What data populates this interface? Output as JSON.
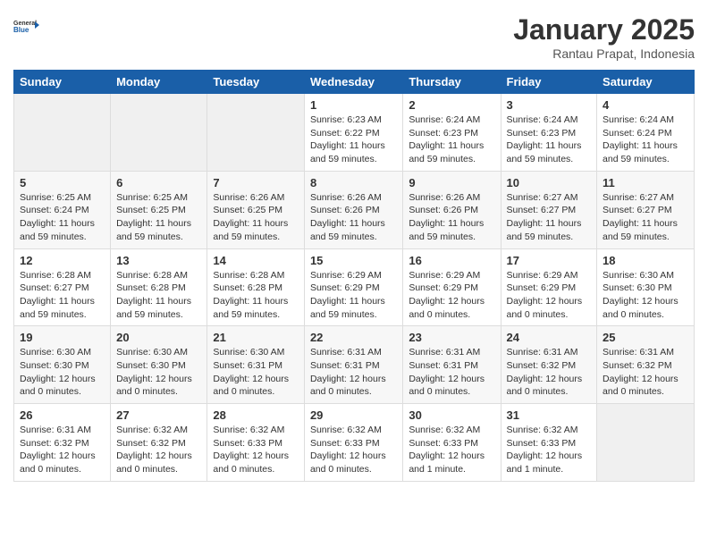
{
  "logo": {
    "general": "General",
    "blue": "Blue"
  },
  "header": {
    "title": "January 2025",
    "location": "Rantau Prapat, Indonesia"
  },
  "weekdays": [
    "Sunday",
    "Monday",
    "Tuesday",
    "Wednesday",
    "Thursday",
    "Friday",
    "Saturday"
  ],
  "weeks": [
    [
      {
        "day": "",
        "sunrise": "",
        "sunset": "",
        "daylight": ""
      },
      {
        "day": "",
        "sunrise": "",
        "sunset": "",
        "daylight": ""
      },
      {
        "day": "",
        "sunrise": "",
        "sunset": "",
        "daylight": ""
      },
      {
        "day": "1",
        "sunrise": "Sunrise: 6:23 AM",
        "sunset": "Sunset: 6:22 PM",
        "daylight": "Daylight: 11 hours and 59 minutes."
      },
      {
        "day": "2",
        "sunrise": "Sunrise: 6:24 AM",
        "sunset": "Sunset: 6:23 PM",
        "daylight": "Daylight: 11 hours and 59 minutes."
      },
      {
        "day": "3",
        "sunrise": "Sunrise: 6:24 AM",
        "sunset": "Sunset: 6:23 PM",
        "daylight": "Daylight: 11 hours and 59 minutes."
      },
      {
        "day": "4",
        "sunrise": "Sunrise: 6:24 AM",
        "sunset": "Sunset: 6:24 PM",
        "daylight": "Daylight: 11 hours and 59 minutes."
      }
    ],
    [
      {
        "day": "5",
        "sunrise": "Sunrise: 6:25 AM",
        "sunset": "Sunset: 6:24 PM",
        "daylight": "Daylight: 11 hours and 59 minutes."
      },
      {
        "day": "6",
        "sunrise": "Sunrise: 6:25 AM",
        "sunset": "Sunset: 6:25 PM",
        "daylight": "Daylight: 11 hours and 59 minutes."
      },
      {
        "day": "7",
        "sunrise": "Sunrise: 6:26 AM",
        "sunset": "Sunset: 6:25 PM",
        "daylight": "Daylight: 11 hours and 59 minutes."
      },
      {
        "day": "8",
        "sunrise": "Sunrise: 6:26 AM",
        "sunset": "Sunset: 6:26 PM",
        "daylight": "Daylight: 11 hours and 59 minutes."
      },
      {
        "day": "9",
        "sunrise": "Sunrise: 6:26 AM",
        "sunset": "Sunset: 6:26 PM",
        "daylight": "Daylight: 11 hours and 59 minutes."
      },
      {
        "day": "10",
        "sunrise": "Sunrise: 6:27 AM",
        "sunset": "Sunset: 6:27 PM",
        "daylight": "Daylight: 11 hours and 59 minutes."
      },
      {
        "day": "11",
        "sunrise": "Sunrise: 6:27 AM",
        "sunset": "Sunset: 6:27 PM",
        "daylight": "Daylight: 11 hours and 59 minutes."
      }
    ],
    [
      {
        "day": "12",
        "sunrise": "Sunrise: 6:28 AM",
        "sunset": "Sunset: 6:27 PM",
        "daylight": "Daylight: 11 hours and 59 minutes."
      },
      {
        "day": "13",
        "sunrise": "Sunrise: 6:28 AM",
        "sunset": "Sunset: 6:28 PM",
        "daylight": "Daylight: 11 hours and 59 minutes."
      },
      {
        "day": "14",
        "sunrise": "Sunrise: 6:28 AM",
        "sunset": "Sunset: 6:28 PM",
        "daylight": "Daylight: 11 hours and 59 minutes."
      },
      {
        "day": "15",
        "sunrise": "Sunrise: 6:29 AM",
        "sunset": "Sunset: 6:29 PM",
        "daylight": "Daylight: 11 hours and 59 minutes."
      },
      {
        "day": "16",
        "sunrise": "Sunrise: 6:29 AM",
        "sunset": "Sunset: 6:29 PM",
        "daylight": "Daylight: 12 hours and 0 minutes."
      },
      {
        "day": "17",
        "sunrise": "Sunrise: 6:29 AM",
        "sunset": "Sunset: 6:29 PM",
        "daylight": "Daylight: 12 hours and 0 minutes."
      },
      {
        "day": "18",
        "sunrise": "Sunrise: 6:30 AM",
        "sunset": "Sunset: 6:30 PM",
        "daylight": "Daylight: 12 hours and 0 minutes."
      }
    ],
    [
      {
        "day": "19",
        "sunrise": "Sunrise: 6:30 AM",
        "sunset": "Sunset: 6:30 PM",
        "daylight": "Daylight: 12 hours and 0 minutes."
      },
      {
        "day": "20",
        "sunrise": "Sunrise: 6:30 AM",
        "sunset": "Sunset: 6:30 PM",
        "daylight": "Daylight: 12 hours and 0 minutes."
      },
      {
        "day": "21",
        "sunrise": "Sunrise: 6:30 AM",
        "sunset": "Sunset: 6:31 PM",
        "daylight": "Daylight: 12 hours and 0 minutes."
      },
      {
        "day": "22",
        "sunrise": "Sunrise: 6:31 AM",
        "sunset": "Sunset: 6:31 PM",
        "daylight": "Daylight: 12 hours and 0 minutes."
      },
      {
        "day": "23",
        "sunrise": "Sunrise: 6:31 AM",
        "sunset": "Sunset: 6:31 PM",
        "daylight": "Daylight: 12 hours and 0 minutes."
      },
      {
        "day": "24",
        "sunrise": "Sunrise: 6:31 AM",
        "sunset": "Sunset: 6:32 PM",
        "daylight": "Daylight: 12 hours and 0 minutes."
      },
      {
        "day": "25",
        "sunrise": "Sunrise: 6:31 AM",
        "sunset": "Sunset: 6:32 PM",
        "daylight": "Daylight: 12 hours and 0 minutes."
      }
    ],
    [
      {
        "day": "26",
        "sunrise": "Sunrise: 6:31 AM",
        "sunset": "Sunset: 6:32 PM",
        "daylight": "Daylight: 12 hours and 0 minutes."
      },
      {
        "day": "27",
        "sunrise": "Sunrise: 6:32 AM",
        "sunset": "Sunset: 6:32 PM",
        "daylight": "Daylight: 12 hours and 0 minutes."
      },
      {
        "day": "28",
        "sunrise": "Sunrise: 6:32 AM",
        "sunset": "Sunset: 6:33 PM",
        "daylight": "Daylight: 12 hours and 0 minutes."
      },
      {
        "day": "29",
        "sunrise": "Sunrise: 6:32 AM",
        "sunset": "Sunset: 6:33 PM",
        "daylight": "Daylight: 12 hours and 0 minutes."
      },
      {
        "day": "30",
        "sunrise": "Sunrise: 6:32 AM",
        "sunset": "Sunset: 6:33 PM",
        "daylight": "Daylight: 12 hours and 1 minute."
      },
      {
        "day": "31",
        "sunrise": "Sunrise: 6:32 AM",
        "sunset": "Sunset: 6:33 PM",
        "daylight": "Daylight: 12 hours and 1 minute."
      },
      {
        "day": "",
        "sunrise": "",
        "sunset": "",
        "daylight": ""
      }
    ]
  ]
}
